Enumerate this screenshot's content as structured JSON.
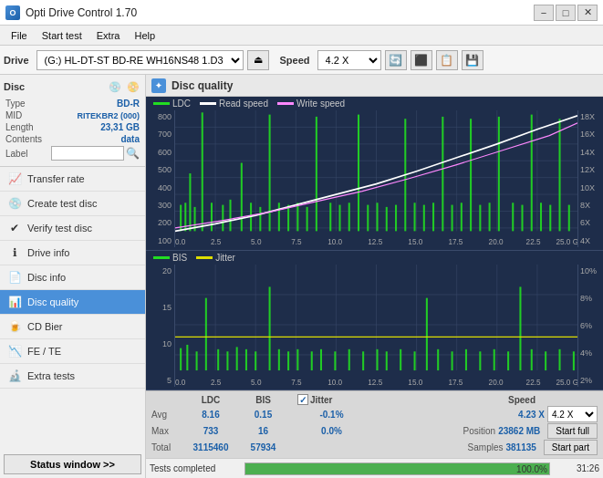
{
  "titlebar": {
    "title": "Opti Drive Control 1.70",
    "icon": "O",
    "min_label": "−",
    "max_label": "□",
    "close_label": "✕"
  },
  "menubar": {
    "items": [
      "File",
      "Start test",
      "Extra",
      "Help"
    ]
  },
  "toolbar": {
    "drive_label": "Drive",
    "drive_value": "(G:)  HL-DT-ST BD-RE  WH16NS48 1.D3",
    "eject_icon": "⏏",
    "speed_label": "Speed",
    "speed_value": "4.2 X",
    "speed_options": [
      "4.2 X"
    ],
    "btn1": "🔄",
    "btn2": "⬛",
    "btn3": "📋",
    "btn4": "💾"
  },
  "sidebar": {
    "disc_section": {
      "title": "Disc",
      "type_label": "Type",
      "type_value": "BD-R",
      "mid_label": "MID",
      "mid_value": "RITEKBR2 (000)",
      "length_label": "Length",
      "length_value": "23,31 GB",
      "contents_label": "Contents",
      "contents_value": "data",
      "label_label": "Label",
      "label_value": ""
    },
    "nav_items": [
      {
        "id": "transfer-rate",
        "label": "Transfer rate",
        "icon": "📈"
      },
      {
        "id": "create-test-disc",
        "label": "Create test disc",
        "icon": "💿"
      },
      {
        "id": "verify-test-disc",
        "label": "Verify test disc",
        "icon": "✔"
      },
      {
        "id": "drive-info",
        "label": "Drive info",
        "icon": "ℹ"
      },
      {
        "id": "disc-info",
        "label": "Disc info",
        "icon": "📄"
      },
      {
        "id": "disc-quality",
        "label": "Disc quality",
        "icon": "📊",
        "active": true
      },
      {
        "id": "cd-bier",
        "label": "CD Bier",
        "icon": "🍺"
      },
      {
        "id": "fe-te",
        "label": "FE / TE",
        "icon": "📉"
      },
      {
        "id": "extra-tests",
        "label": "Extra tests",
        "icon": "🔬"
      }
    ],
    "status_btn": "Status window >>"
  },
  "panel": {
    "title": "Disc quality",
    "legend1": {
      "ldc": "LDC",
      "read_speed": "Read speed",
      "write_speed": "Write speed"
    },
    "legend2": {
      "bis": "BIS",
      "jitter": "Jitter"
    },
    "chart1": {
      "y_labels_left": [
        "100",
        "200",
        "300",
        "400",
        "500",
        "600",
        "700",
        "800"
      ],
      "y_labels_right": [
        "4X",
        "6X",
        "8X",
        "10X",
        "12X",
        "14X",
        "16X",
        "18X"
      ],
      "x_labels": [
        "0.0",
        "2.5",
        "5.0",
        "7.5",
        "10.0",
        "12.5",
        "15.0",
        "17.5",
        "20.0",
        "22.5",
        "25.0 GB"
      ]
    },
    "chart2": {
      "y_labels_left": [
        "5",
        "10",
        "15",
        "20"
      ],
      "y_labels_right": [
        "2%",
        "4%",
        "6%",
        "8%",
        "10%"
      ],
      "x_labels": [
        "0.0",
        "2.5",
        "5.0",
        "7.5",
        "10.0",
        "12.5",
        "15.0",
        "17.5",
        "20.0",
        "22.5",
        "25.0 GB"
      ]
    }
  },
  "stats": {
    "headers": [
      "",
      "LDC",
      "BIS",
      "",
      "Jitter",
      "Speed",
      ""
    ],
    "avg_label": "Avg",
    "avg_ldc": "8.16",
    "avg_bis": "0.15",
    "avg_jitter": "-0.1%",
    "max_label": "Max",
    "max_ldc": "733",
    "max_bis": "16",
    "max_jitter": "0.0%",
    "total_label": "Total",
    "total_ldc": "3115460",
    "total_bis": "57934",
    "speed_label": "Speed",
    "speed_value": "4.23 X",
    "speed_select": "4.2 X",
    "position_label": "Position",
    "position_value": "23862 MB",
    "samples_label": "Samples",
    "samples_value": "381135",
    "jitter_checked": true,
    "jitter_label": "Jitter",
    "start_full_label": "Start full",
    "start_part_label": "Start part"
  },
  "progress": {
    "status_text": "Tests completed",
    "progress_pct": 100,
    "time_display": "31:26"
  },
  "colors": {
    "accent_blue": "#4a90d9",
    "dark_bg": "#1e2d4a",
    "ldc_bar": "#22dd22",
    "bis_bar": "#22dd22",
    "read_speed_line": "#ffffff",
    "write_speed_line": "#ff88ff",
    "jitter_line": "#dddd00",
    "progress_green": "#4CAF50"
  }
}
